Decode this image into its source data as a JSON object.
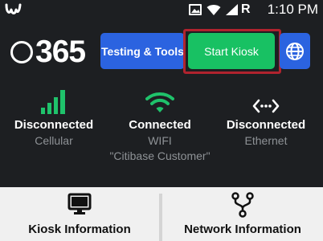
{
  "status_bar": {
    "carrier": "R",
    "time": "1:10 PM"
  },
  "brand": {
    "text": "365"
  },
  "buttons": {
    "testing_tools": "Testing & Tools",
    "start_kiosk": "Start Kiosk"
  },
  "connections": {
    "cellular": {
      "state": "Disconnected",
      "kind": "Cellular"
    },
    "wifi": {
      "state": "Connected",
      "kind": "WIFI",
      "ssid": "\"Citibase Customer\""
    },
    "ethernet": {
      "state": "Disconnected",
      "kind": "Ethernet"
    }
  },
  "cards": {
    "kiosk_info": "Kiosk Information",
    "network_info": "Network Information"
  },
  "colors": {
    "background": "#1d1f22",
    "primary_blue": "#2b63e0",
    "kiosk_green": "#18c163",
    "signal_green": "#1fc26b",
    "highlight_red": "#b0232e",
    "muted_text": "#8e9296",
    "card_bg": "#f0f0f0"
  },
  "icons": {
    "app_logo": "w-logo-icon",
    "media": "image-icon",
    "wifi_status": "wifi-icon",
    "signal_status": "cell-signal-icon",
    "globe": "globe-icon",
    "cellular": "cell-bars-icon",
    "wifi": "wifi-icon",
    "ethernet": "ethernet-icon",
    "monitor": "monitor-icon",
    "network": "network-fork-icon"
  }
}
